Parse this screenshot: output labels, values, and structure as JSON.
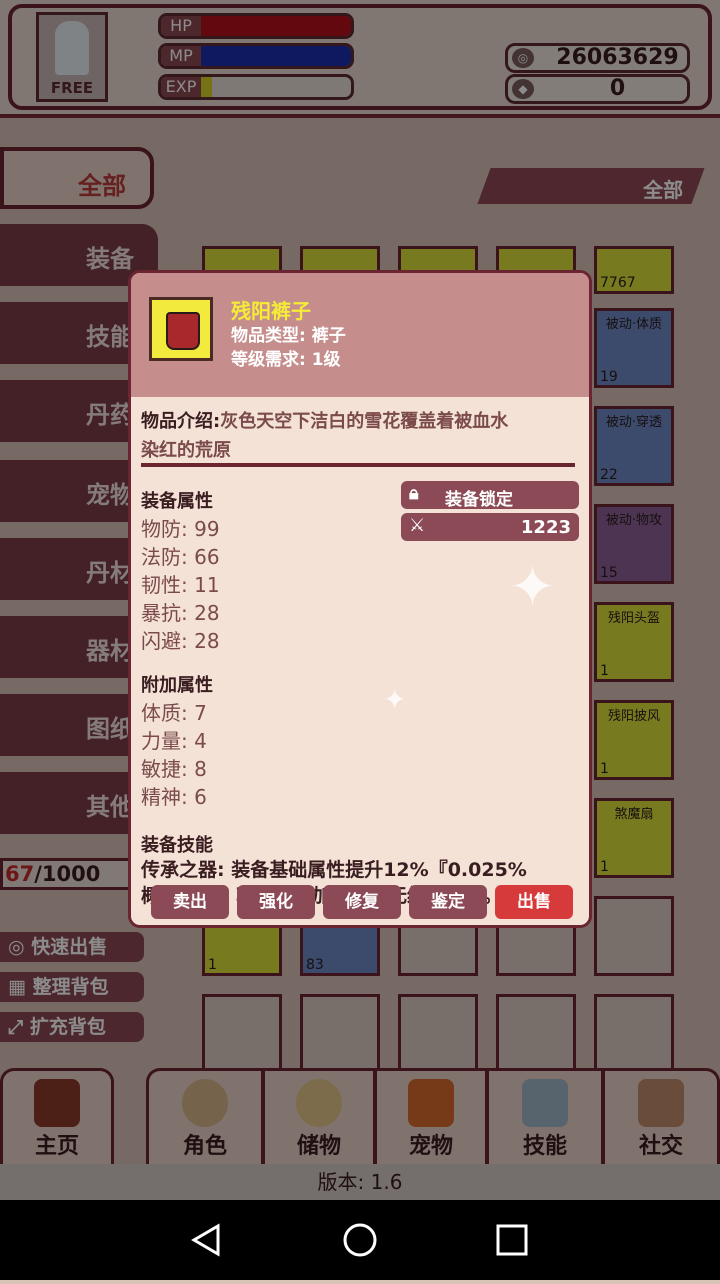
{
  "player": {
    "avatar_tag": "FREE",
    "hp_label": "HP",
    "mp_label": "MP",
    "exp_label": "EXP",
    "hp_level": 1.0,
    "mp_level": 1.0,
    "exp_level": 0.07
  },
  "currency": {
    "gold": "26063629",
    "gems": "0"
  },
  "categories": [
    "全部",
    "装备",
    "技能",
    "丹药",
    "宠物",
    "丹材",
    "器材",
    "图纸",
    "其他"
  ],
  "filter_label": "全部",
  "inventory": {
    "capacity_used": "67",
    "capacity_total": "/1000",
    "right_slots": [
      {
        "name": "",
        "count": "7767"
      },
      {
        "name": "被动·体质",
        "count": "19"
      },
      {
        "name": "被动·穿透",
        "count": "22"
      },
      {
        "name": "被动·物攻",
        "count": "15"
      },
      {
        "name": "残阳头盔",
        "count": "1"
      },
      {
        "name": "残阳披风",
        "count": "1"
      },
      {
        "name": "煞魔扇",
        "count": "1"
      }
    ],
    "bottom_slots": [
      {
        "count": "1"
      },
      {
        "count": "83"
      }
    ]
  },
  "actions": [
    "快速出售",
    "整理背包",
    "扩充背包"
  ],
  "nav": [
    "主页",
    "角色",
    "储物",
    "宠物",
    "技能",
    "社交"
  ],
  "version": "版本: 1.6",
  "dialog": {
    "name": "残阳裤子",
    "type": "物品类型: 裤子",
    "level": "等级需求: 1级",
    "desc_key": "物品介绍:",
    "desc_line1": "灰色天空下洁白的雪花覆盖着被血水",
    "desc_line2": "染红的荒原",
    "equip_title": "装备属性",
    "equip_stats": [
      "物防: 99",
      "法防: 66",
      "韧性: 11",
      "暴抗: 28",
      "闪避: 28"
    ],
    "lock_label": "装备锁定",
    "power_value": "1223",
    "extra_title": "附加属性",
    "extra_stats": [
      "体质: 7",
      "力量: 4",
      "敏捷: 8",
      "精神: 6"
    ],
    "skill_title": "装备技能",
    "skill_line1": "传承之器: 装备基础属性提升12%『0.025%",
    "skill_line2": "概率出现』享受强化加成，且无级别限制。",
    "buttons": [
      "卖出",
      "强化",
      "修复",
      "鉴定",
      "出售"
    ]
  }
}
